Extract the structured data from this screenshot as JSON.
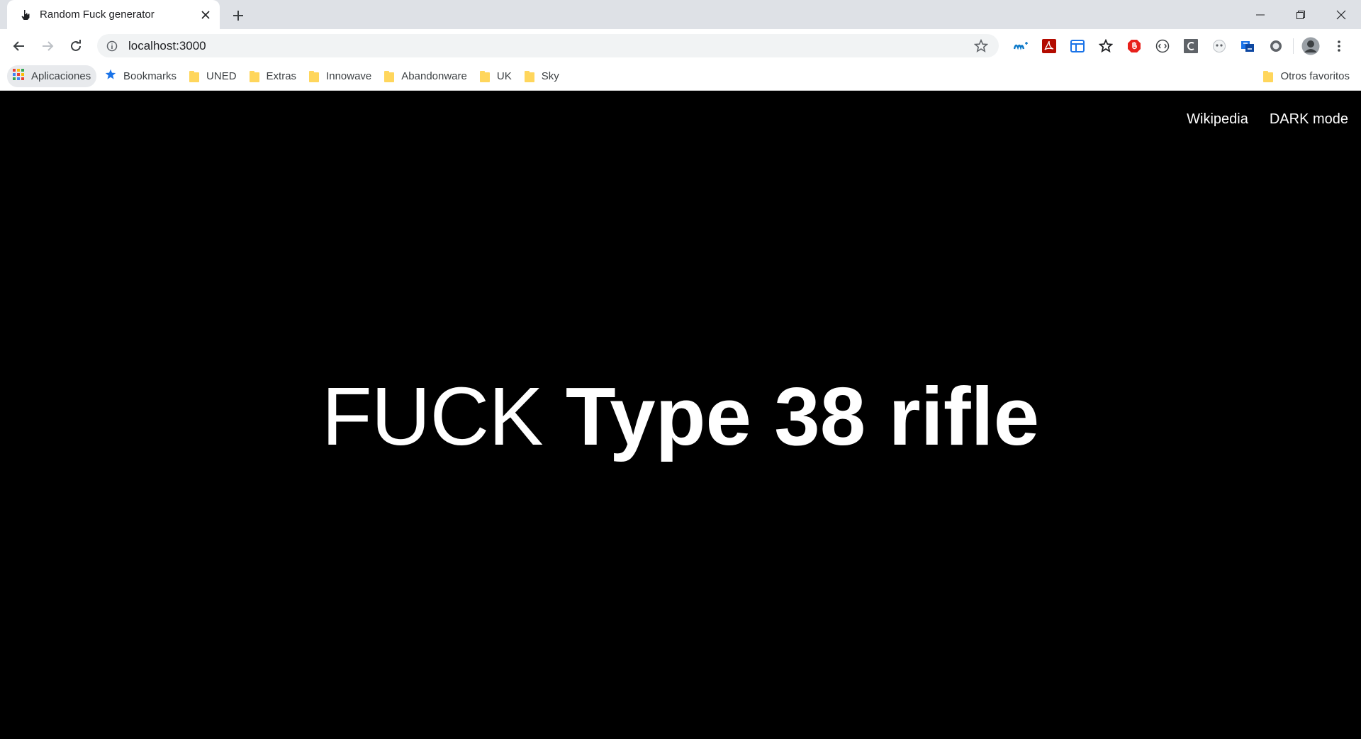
{
  "browser": {
    "tab": {
      "title": "Random Fuck generator",
      "favicon": "hand-pointer-icon"
    },
    "address_bar": {
      "url": "localhost:3000"
    },
    "extensions": [
      "movistar-icon",
      "acrobat-icon",
      "translate-icon",
      "star-icon",
      "adblock-icon",
      "code-icon",
      "c-icon",
      "panda-icon",
      "translate-alt-icon",
      "circle-icon",
      "profile-avatar",
      "menu-icon"
    ]
  },
  "bookmarks": {
    "apps_label": "Aplicaciones",
    "items": [
      {
        "label": "Bookmarks",
        "icon": "star-icon"
      },
      {
        "label": "UNED",
        "icon": "folder-icon"
      },
      {
        "label": "Extras",
        "icon": "folder-icon"
      },
      {
        "label": "Innowave",
        "icon": "folder-icon"
      },
      {
        "label": "Abandonware",
        "icon": "folder-icon"
      },
      {
        "label": "UK",
        "icon": "folder-icon"
      },
      {
        "label": "Sky",
        "icon": "folder-icon"
      }
    ],
    "other_label": "Otros favoritos"
  },
  "page": {
    "nav": {
      "wikipedia": "Wikipedia",
      "dark_mode": "DARK mode"
    },
    "headline": {
      "prefix": "FUCK",
      "subject": "Type 38 rifle"
    }
  },
  "colors": {
    "page_bg": "#000000",
    "text": "#ffffff",
    "tabstrip_bg": "#dee1e6"
  }
}
